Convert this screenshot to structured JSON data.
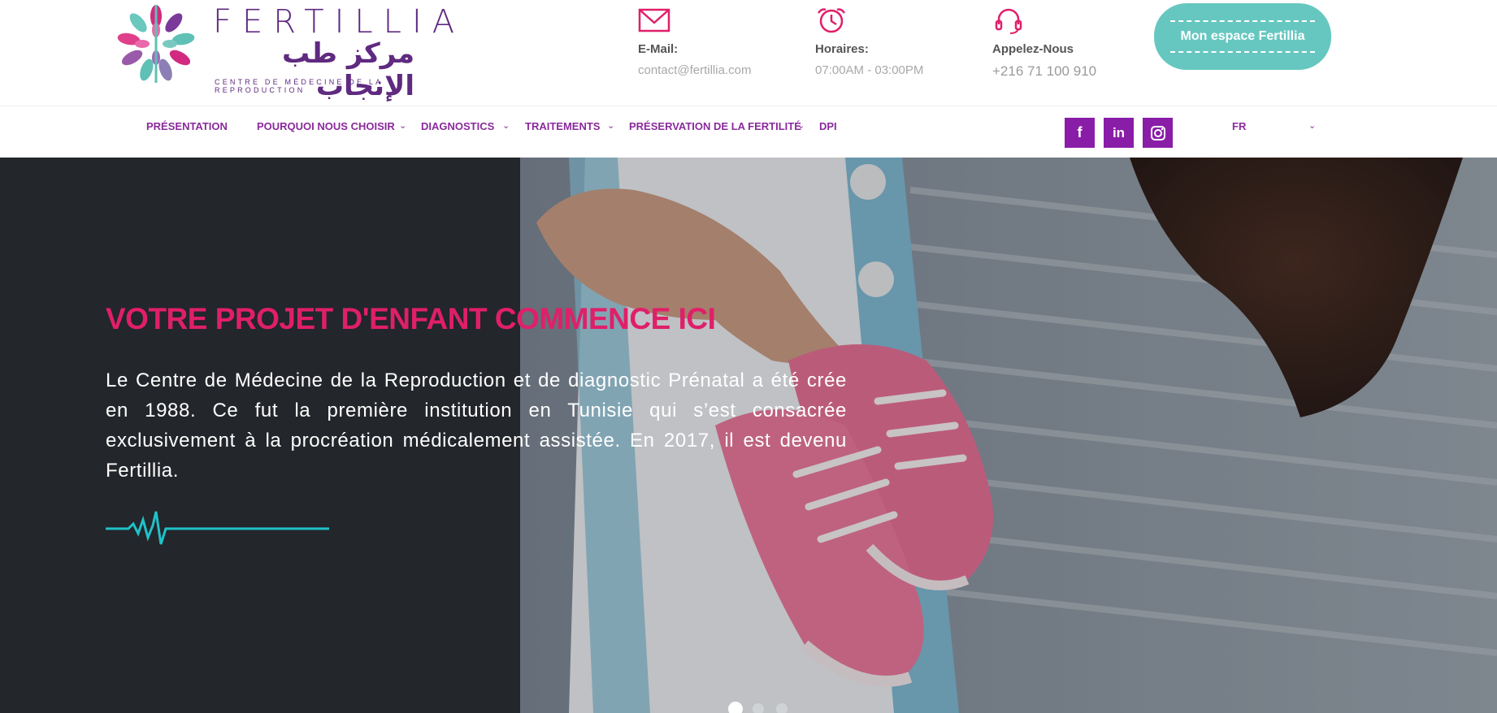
{
  "brand": {
    "name": "FERTILLIA",
    "arabic": "مركز طب الإنجاب",
    "tagline": "CENTRE DE MÉDECINE DE LA REPRODUCTION"
  },
  "contacts": [
    {
      "label": "E-Mail:",
      "value": "contact@fertillia.com",
      "icon": "envelope-icon"
    },
    {
      "label": "Horaires:",
      "value": "07:00AM - 03:00PM",
      "icon": "alarm-clock-icon"
    },
    {
      "label": "Appelez-Nous",
      "value": "+216 71 100 910",
      "icon": "headset-icon"
    }
  ],
  "espace_button": "Mon espace Fertillia",
  "nav": {
    "items": [
      {
        "label": "PRÉSENTATION"
      },
      {
        "label": "POURQUOI NOUS CHOISIR"
      },
      {
        "label": "DIAGNOSTICS"
      },
      {
        "label": "TRAITEMENTS"
      },
      {
        "label": "PRÉSERVATION DE LA FERTILITÉ"
      },
      {
        "label": "DPI"
      }
    ],
    "social": [
      {
        "icon": "facebook-icon",
        "glyph": "f"
      },
      {
        "icon": "linkedin-icon",
        "glyph": "in"
      },
      {
        "icon": "instagram-icon",
        "glyph": ""
      }
    ],
    "language": "FR"
  },
  "hero": {
    "title": "VOTRE PROJET D'ENFANT COMMENCE ICI",
    "text": "Le Centre de Médecine de la Reproduction et de diagnostic Prénatal a été crée en 1988. Ce fut la première institution en Tunisie qui s’est consacrée exclusivement à la procréation médicalement assistée. En 2017, il est devenu Fertillia.",
    "slides": 3,
    "active_slide": 1
  },
  "colors": {
    "purple": "#8a1da8",
    "brand_purple": "#5f2a80",
    "pink": "#e01f69",
    "teal": "#66c7c0"
  }
}
